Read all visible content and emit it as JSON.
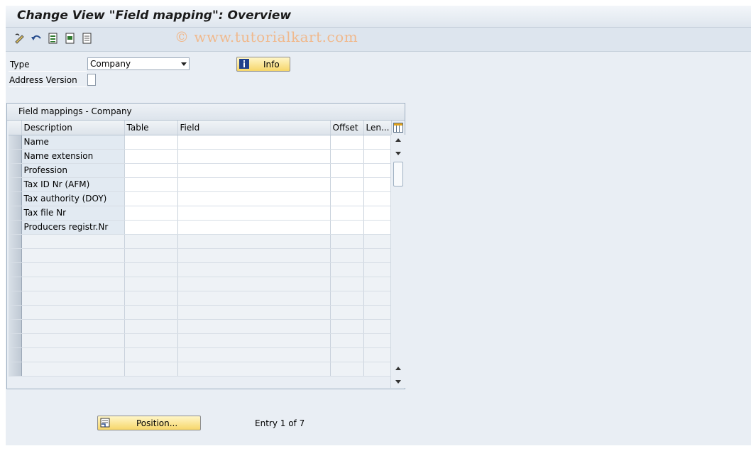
{
  "window": {
    "title": "Change View \"Field mapping\": Overview"
  },
  "toolbar": {
    "icons": [
      "edit-icon",
      "undo-icon",
      "select-all-icon",
      "select-block-icon",
      "deselect-icon"
    ]
  },
  "watermark": "© www.tutorialkart.com",
  "form": {
    "type_label": "Type",
    "type_value": "Company",
    "address_version_label": "Address Version",
    "info_button": "Info"
  },
  "table": {
    "title": "Field mappings - Company",
    "columns": [
      "Description",
      "Table",
      "Field",
      "Offset",
      "Len..."
    ],
    "rows": [
      "Name",
      "Name extension",
      "Profession",
      "Tax ID Nr (AFM)",
      "Tax authority (DOY)",
      "Tax file Nr",
      "Producers registr.Nr"
    ],
    "empty_rows": 10
  },
  "footer": {
    "position_button": "Position...",
    "entry_text": "Entry 1 of 7"
  },
  "colors": {
    "background": "#e9eef4",
    "button": "#f6d66a",
    "watermark": "#f0b98d"
  }
}
